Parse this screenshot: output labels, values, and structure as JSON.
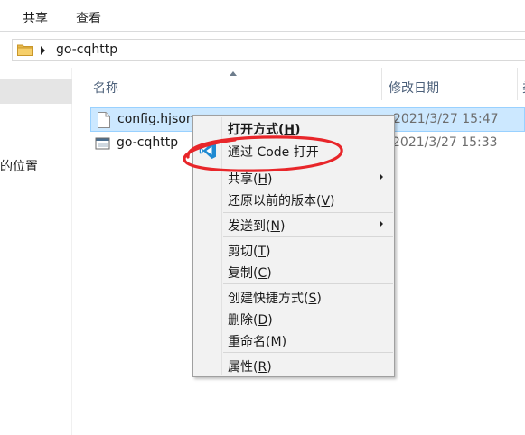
{
  "ribbon": {
    "tabs": [
      "共享",
      "查看"
    ]
  },
  "address_bar": {
    "path": "go-cqhttp"
  },
  "nav_pane": {
    "items": [
      "的位置"
    ]
  },
  "columns": {
    "name": "名称",
    "date_modified": "修改日期",
    "extra": "类"
  },
  "files": [
    {
      "name": "config.hjson",
      "date": "2021/3/27 15:47",
      "selected": true,
      "icon": "text-file-icon"
    },
    {
      "name": "go-cqhttp",
      "date": "2021/3/27 15:33",
      "selected": false,
      "icon": "exe-file-icon"
    }
  ],
  "context_menu": {
    "open_with": {
      "label": "打开方式(",
      "key": "H",
      "tail": ")"
    },
    "open_with_code": {
      "label": "通过 Code 打开",
      "icon": "vscode-icon"
    },
    "share": {
      "label": "共享(",
      "key": "H",
      "tail": ")"
    },
    "restore_versions": {
      "label": "还原以前的版本(",
      "key": "V",
      "tail": ")"
    },
    "send_to": {
      "label": "发送到(",
      "key": "N",
      "tail": ")"
    },
    "cut": {
      "label": "剪切(",
      "key": "T",
      "tail": ")"
    },
    "copy": {
      "label": "复制(",
      "key": "C",
      "tail": ")"
    },
    "create_shortcut": {
      "label": "创建快捷方式(",
      "key": "S",
      "tail": ")"
    },
    "delete": {
      "label": "删除(",
      "key": "D",
      "tail": ")"
    },
    "rename": {
      "label": "重命名(",
      "key": "M",
      "tail": ")"
    },
    "properties": {
      "label": "属性(",
      "key": "R",
      "tail": ")"
    }
  },
  "colors": {
    "selection_bg": "#cce8ff",
    "selection_border": "#99d1ff",
    "menu_bg": "#f2f2f2",
    "annotation_red": "#e8262a",
    "vscode_blue": "#1f8ad2"
  }
}
